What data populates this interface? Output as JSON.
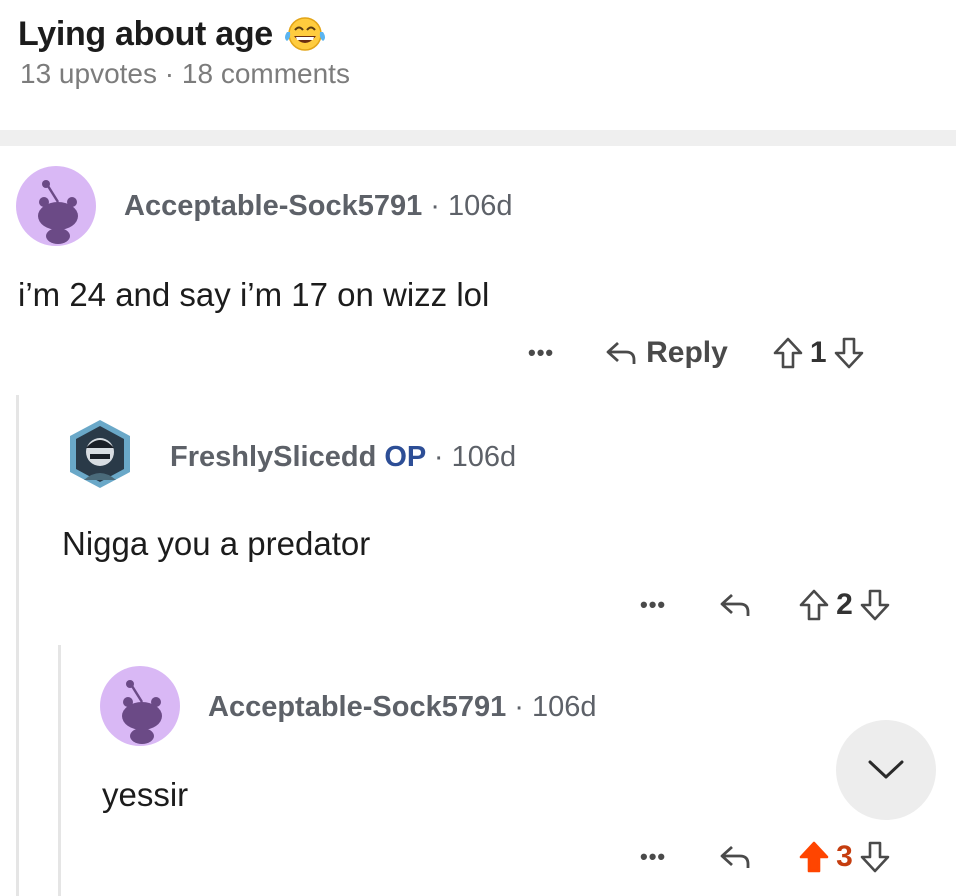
{
  "post": {
    "title": "Lying about age",
    "upvotes": "13 upvotes",
    "separator": "·",
    "comments": "18 comments"
  },
  "comments": [
    {
      "author": "Acceptable-Sock5791",
      "dot": "·",
      "age": "106d",
      "body": "i’m 24 and say i’m 17 on wizz lol",
      "more": "•••",
      "reply_label": "Reply",
      "score": "1"
    },
    {
      "author": "FreshlySlicedd",
      "op_tag": "OP",
      "dot": "·",
      "age": "106d",
      "body": "Nigga you a predator",
      "more": "•••",
      "score": "2"
    },
    {
      "author": "Acceptable-Sock5791",
      "dot": "·",
      "age": "106d",
      "body": "yessir",
      "more": "•••",
      "score": "3",
      "upvoted": true
    }
  ],
  "colors": {
    "upvote_active": "#ff4500",
    "op_tag": "#2d4e96",
    "avatar_bg": "#d9b8f5"
  },
  "icons": {
    "emoji": "face-with-tears-of-joy-icon",
    "reply": "reply-arrow-icon",
    "upvote": "upvote-arrow-icon",
    "downvote": "downvote-arrow-icon",
    "scroll": "chevron-down-icon"
  }
}
